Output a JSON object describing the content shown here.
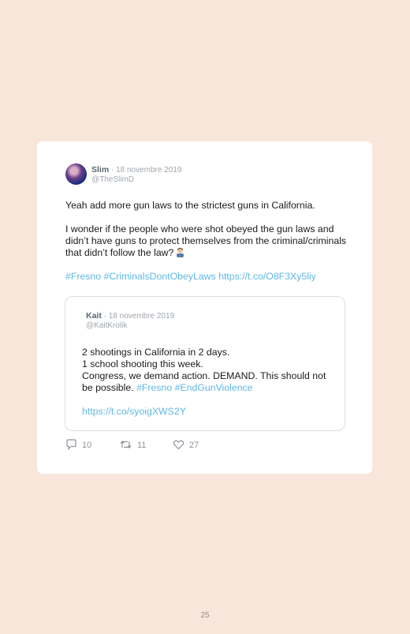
{
  "tweet": {
    "author_name": "Slim",
    "date": " · 18 novembre 2019",
    "handle": "@TheSlimD",
    "line1": "Yeah add more gun laws to the strictest guns in California.",
    "line2": "I wonder if the people who were shot obeyed the gun laws and didn’t have guns to protect themselves from the criminal/criminals that didn’t follow the law?",
    "hashtag1": "#Fresno",
    "hashtag2": "#CriminalsDontObeyLaws",
    "link": "https://t.co/O8F3Xy5liy"
  },
  "quoted": {
    "author_name": "Kait",
    "date": " · 18 novembre 2019",
    "handle": "@KaitKrolik",
    "line1": "2 shootings in California in 2 days.",
    "line2": "1 school shooting this week.",
    "line3": "Congress, we demand action. DEMAND. This should not be possible.",
    "hashtag1": "#Fresno",
    "hashtag2": "#EndGunViolence",
    "link": "https://t.co/syoigXWS2Y"
  },
  "actions": {
    "replies": "10",
    "retweets": "11",
    "likes": "27"
  },
  "page_number": "25",
  "colors": {
    "background": "#f9e6db",
    "link": "#5fb8e6"
  }
}
